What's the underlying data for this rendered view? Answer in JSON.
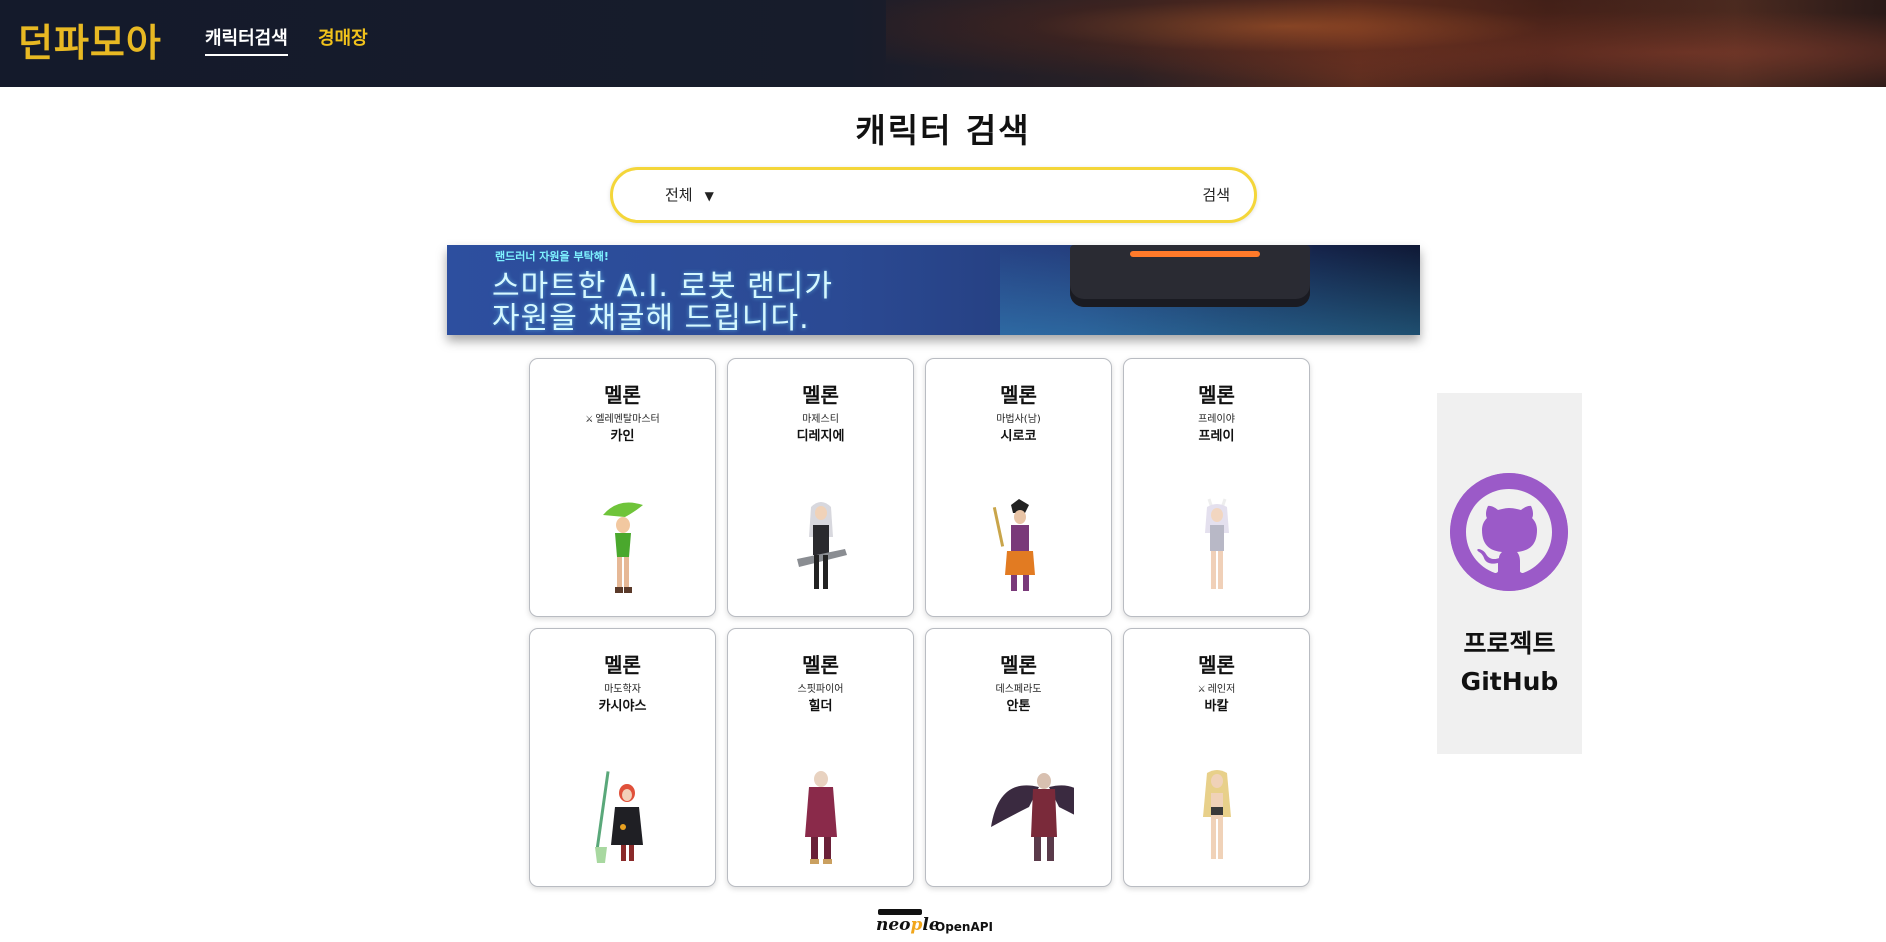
{
  "header": {
    "logo": "던파모아",
    "nav": [
      {
        "label": "캐릭터검색",
        "active": true
      },
      {
        "label": "경매장",
        "active": false
      }
    ]
  },
  "main": {
    "title": "캐릭터 검색",
    "search": {
      "server_selected": "전체",
      "input_value": "",
      "button_label": "검색"
    },
    "banner": {
      "top_text": "랜드러너 자원을 부탁해!",
      "line1": "스마트한 A.I. 로봇 랜디가",
      "line2": "자원을 채굴해 드립니다."
    },
    "cards": [
      {
        "server": "멜론",
        "job": "엘레멘탈마스터",
        "name": "카인",
        "awakened": true
      },
      {
        "server": "멜론",
        "job": "마제스티",
        "name": "디레지에",
        "awakened": false
      },
      {
        "server": "멜론",
        "job": "마법사(남)",
        "name": "시로코",
        "awakened": false
      },
      {
        "server": "멜론",
        "job": "프레이야",
        "name": "프레이",
        "awakened": false
      },
      {
        "server": "멜론",
        "job": "마도학자",
        "name": "카시야스",
        "awakened": false
      },
      {
        "server": "멜론",
        "job": "스핏파이어",
        "name": "힐더",
        "awakened": false
      },
      {
        "server": "멜론",
        "job": "데스페라도",
        "name": "안톤",
        "awakened": false
      },
      {
        "server": "멜론",
        "job": "레인저",
        "name": "바칼",
        "awakened": true
      }
    ]
  },
  "sidebar": {
    "github_line1": "프로젝트",
    "github_line2": "GitHub"
  },
  "footer": {
    "brand_pre": "neo",
    "brand_p": "p",
    "brand_post": "le",
    "api_label": "OpenAPI"
  },
  "colors": {
    "accent_yellow": "#f1c21b",
    "search_border": "#f4d63a",
    "github_purple": "#9b5ac8",
    "header_bg": "#141a2b"
  }
}
